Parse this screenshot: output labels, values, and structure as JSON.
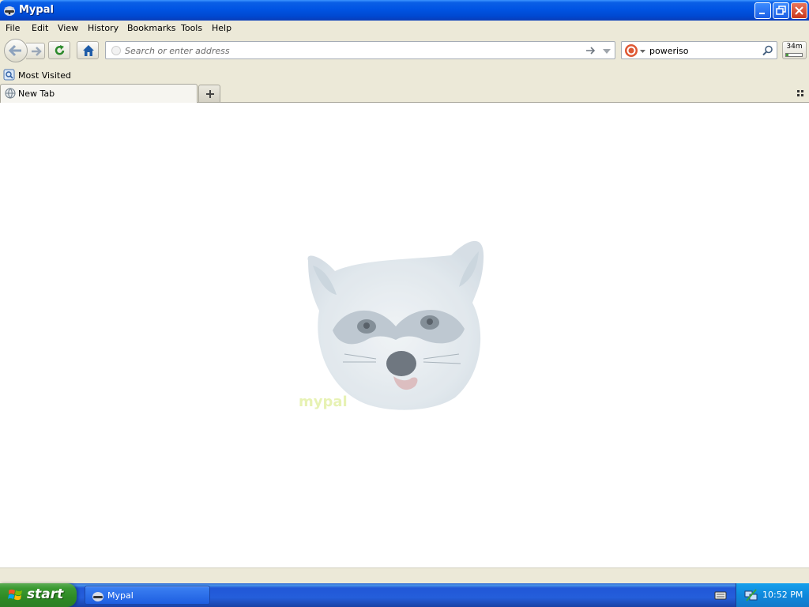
{
  "window": {
    "title": "Mypal"
  },
  "menu": [
    "File",
    "Edit",
    "View",
    "History",
    "Bookmarks",
    "Tools",
    "Help"
  ],
  "nav": {
    "url_placeholder": "Search or enter address",
    "search_value": "poweriso",
    "downloads_badge": "34m"
  },
  "bookmarks": [
    {
      "label": "Most Visited"
    }
  ],
  "tabs": [
    {
      "label": "New Tab"
    }
  ],
  "content": {
    "logo_text": "mypal"
  },
  "taskbar": {
    "start_label": "start",
    "task_label": "Mypal",
    "clock": "10:52 PM"
  },
  "colors": {
    "titlebar": "#0054e3",
    "taskbar": "#245edb",
    "start": "#3c9a33",
    "tray": "#0f89dd"
  }
}
